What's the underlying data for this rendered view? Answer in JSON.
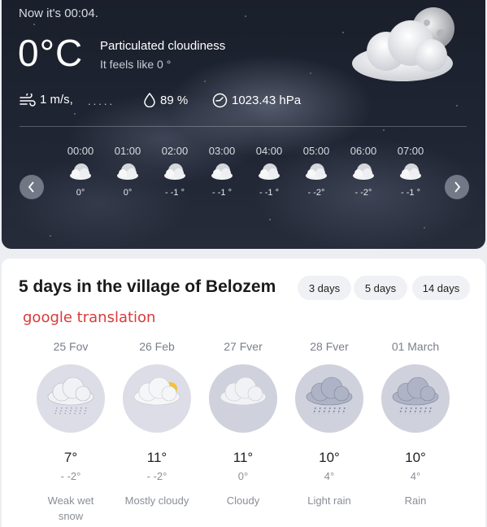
{
  "current": {
    "now_label": "Now it's 00:04.",
    "temperature": "0°C",
    "condition": "Particulated cloudiness",
    "feels_like": "It feels like 0 °",
    "wind": "1 m/s,",
    "wind_dots": ".....",
    "humidity": "89 %",
    "pressure": "1023.43 hPa",
    "icon": "moon-cloud-icon"
  },
  "hourly": [
    {
      "time": "00:00",
      "temp": "0°",
      "icon": "moon-cloud-icon"
    },
    {
      "time": "01:00",
      "temp": "0°",
      "icon": "moon-cloud-icon"
    },
    {
      "time": "02:00",
      "temp": "- -1 °",
      "icon": "moon-cloud-icon"
    },
    {
      "time": "03:00",
      "temp": "- -1 °",
      "icon": "moon-cloud-icon"
    },
    {
      "time": "04:00",
      "temp": "- -1 °",
      "icon": "moon-cloud-icon"
    },
    {
      "time": "05:00",
      "temp": "- -2°",
      "icon": "moon-cloud-icon"
    },
    {
      "time": "06:00",
      "temp": "- -2°",
      "icon": "moon-cloud-icon"
    },
    {
      "time": "07:00",
      "temp": "- -1 °",
      "icon": "moon-cloud-icon"
    }
  ],
  "forecast": {
    "title": "5 days in the village of Belozem",
    "tabs": [
      "3 days",
      "5 days",
      "14 days"
    ],
    "translation_note": "google translation",
    "days": [
      {
        "date": "25 Fov",
        "high": "7°",
        "low": "- -2°",
        "desc": "Weak wet snow",
        "icon": "rain-snow-cloud-icon"
      },
      {
        "date": "26 Feb",
        "high": "11°",
        "low": "- -2°",
        "desc": "Mostly cloudy",
        "icon": "sun-cloud-icon"
      },
      {
        "date": "27 Fver",
        "high": "11°",
        "low": "0°",
        "desc": "Cloudy",
        "icon": "cloud-icon"
      },
      {
        "date": "28 Fver",
        "high": "10°",
        "low": "4°",
        "desc": "Light rain",
        "icon": "rain-cloud-icon"
      },
      {
        "date": "01 March",
        "high": "10°",
        "low": "4°",
        "desc": "Rain",
        "icon": "rain-cloud-icon"
      }
    ]
  },
  "colors": {
    "translation_note": "#d93a3a",
    "panel_bg": "#1f2533"
  }
}
